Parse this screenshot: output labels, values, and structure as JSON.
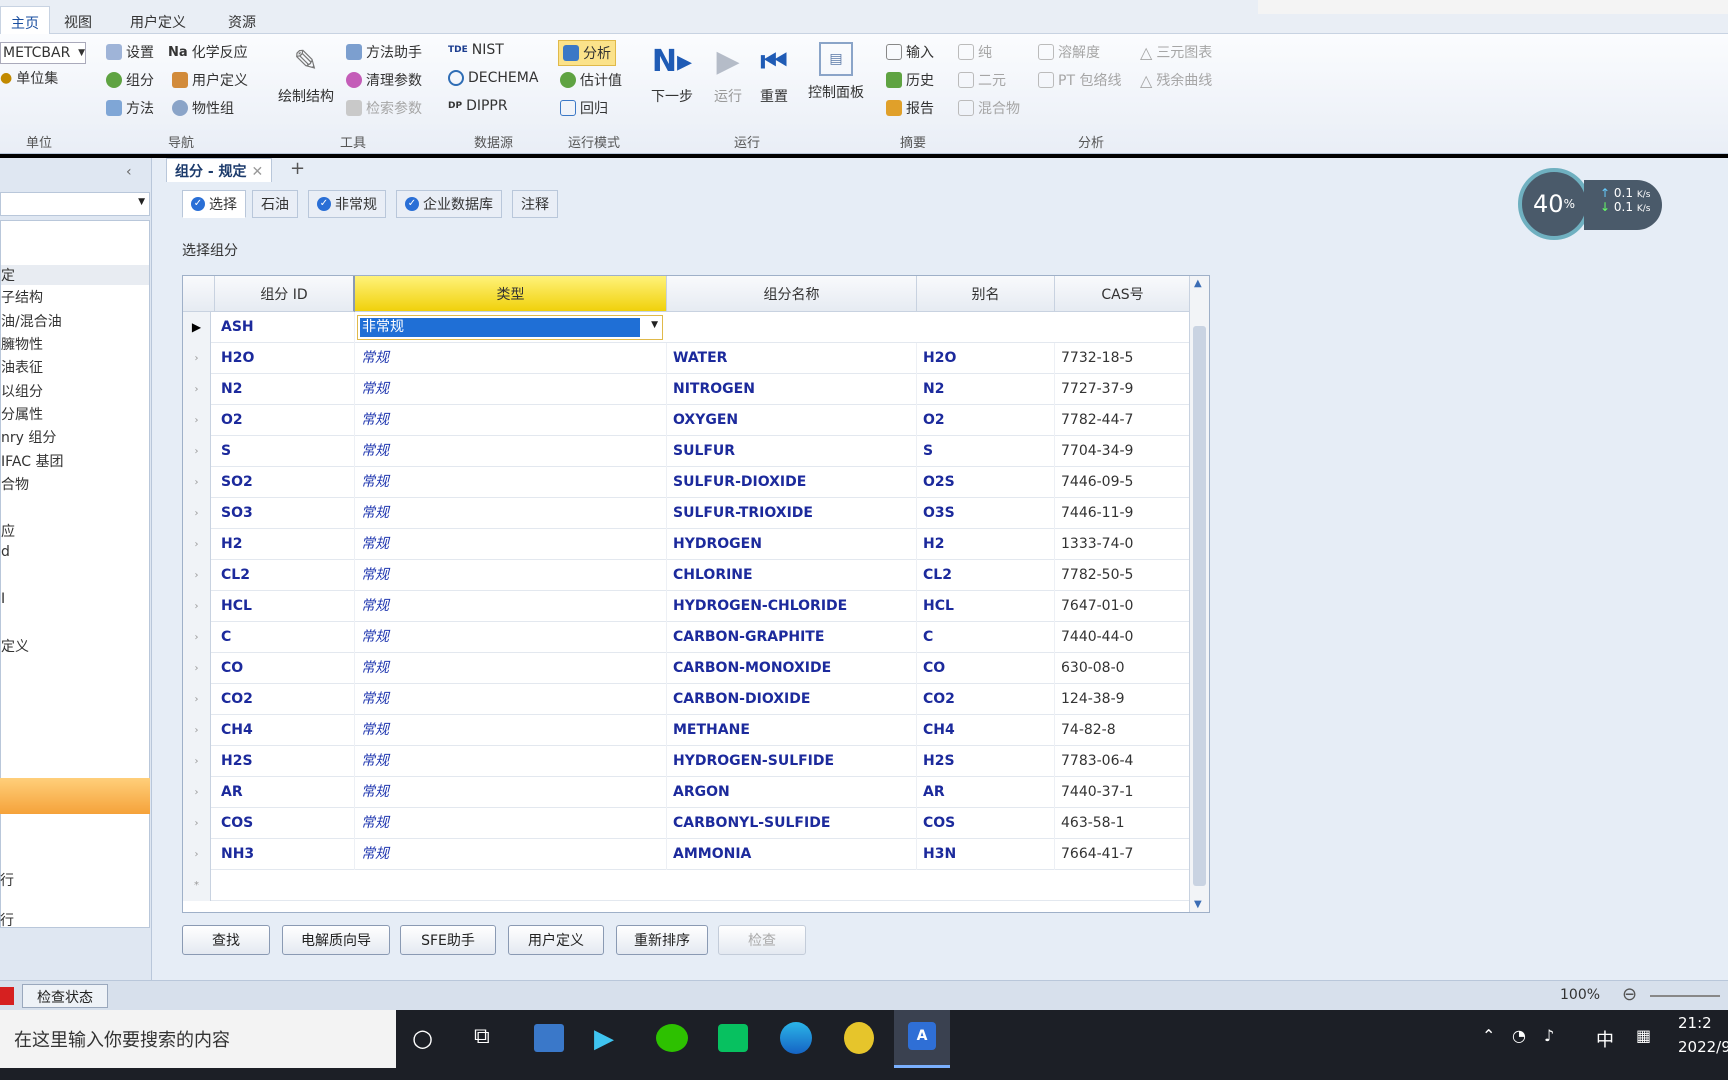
{
  "ribbon_tabs": [
    "主页",
    "视图",
    "用户定义",
    "资源"
  ],
  "units_select": "METCBAR",
  "ribbon": {
    "unit_set": "单位集",
    "nav": [
      "设置",
      "组分",
      "方法",
      "化学反应",
      "用户定义",
      "物性组"
    ],
    "draw_structure": "绘制结构",
    "tools": [
      "方法助手",
      "清理参数",
      "检索参数"
    ],
    "datasource": [
      "NIST",
      "DECHEMA",
      "DIPPR"
    ],
    "run_mode": [
      "分析",
      "估计值",
      "回归"
    ],
    "run": [
      "下一步",
      "运行",
      "重置",
      "控制面板"
    ],
    "summary": [
      "输入",
      "历史",
      "报告"
    ],
    "analysis": [
      "纯",
      "二元",
      "混合物",
      "溶解度",
      "PT 包络线",
      "三元图表",
      "残余曲线"
    ],
    "groups": [
      "单位",
      "导航",
      "工具",
      "数据源",
      "运行模式",
      "运行",
      "摘要",
      "分析"
    ]
  },
  "speed_widget": {
    "percent": "40",
    "unit": "%",
    "up": "0.1",
    "down": "0.1",
    "rate_unit": "K/s"
  },
  "leftnav": {
    "items": [
      "定",
      "子结构",
      "油/混合油",
      "臃物性",
      "油表征",
      "以组分",
      "分属性",
      "nry 组分",
      "IFAC 基团",
      "合物",
      "",
      "应",
      "d",
      "",
      "I",
      "",
      "定义"
    ],
    "bottom_items": [
      "行",
      "行"
    ]
  },
  "doc_tab": "组分 - 规定",
  "sub_tabs": [
    "选择",
    "石油",
    "非常规",
    "企业数据库",
    "注释"
  ],
  "section_title": "选择组分",
  "table": {
    "headers": [
      "组分 ID",
      "类型",
      "组分名称",
      "别名",
      "CAS号"
    ],
    "first_row": {
      "id": "ASH",
      "type": "非常规"
    },
    "rows": [
      [
        "H2O",
        "常规",
        "WATER",
        "H2O",
        "7732-18-5"
      ],
      [
        "N2",
        "常规",
        "NITROGEN",
        "N2",
        "7727-37-9"
      ],
      [
        "O2",
        "常规",
        "OXYGEN",
        "O2",
        "7782-44-7"
      ],
      [
        "S",
        "常规",
        "SULFUR",
        "S",
        "7704-34-9"
      ],
      [
        "SO2",
        "常规",
        "SULFUR-DIOXIDE",
        "O2S",
        "7446-09-5"
      ],
      [
        "SO3",
        "常规",
        "SULFUR-TRIOXIDE",
        "O3S",
        "7446-11-9"
      ],
      [
        "H2",
        "常规",
        "HYDROGEN",
        "H2",
        "1333-74-0"
      ],
      [
        "CL2",
        "常规",
        "CHLORINE",
        "CL2",
        "7782-50-5"
      ],
      [
        "HCL",
        "常规",
        "HYDROGEN-CHLORIDE",
        "HCL",
        "7647-01-0"
      ],
      [
        "C",
        "常规",
        "CARBON-GRAPHITE",
        "C",
        "7440-44-0"
      ],
      [
        "CO",
        "常规",
        "CARBON-MONOXIDE",
        "CO",
        "630-08-0"
      ],
      [
        "CO2",
        "常规",
        "CARBON-DIOXIDE",
        "CO2",
        "124-38-9"
      ],
      [
        "CH4",
        "常规",
        "METHANE",
        "CH4",
        "74-82-8"
      ],
      [
        "H2S",
        "常规",
        "HYDROGEN-SULFIDE",
        "H2S",
        "7783-06-4"
      ],
      [
        "AR",
        "常规",
        "ARGON",
        "AR",
        "7440-37-1"
      ],
      [
        "COS",
        "常规",
        "CARBONYL-SULFIDE",
        "COS",
        "463-58-1"
      ],
      [
        "NH3",
        "常规",
        "AMMONIA",
        "H3N",
        "7664-41-7"
      ]
    ]
  },
  "buttons": [
    "查找",
    "电解质向导",
    "SFE助手",
    "用户定义",
    "重新排序",
    "检查"
  ],
  "status": {
    "check": "检查状态",
    "zoom": "100%"
  },
  "taskbar": {
    "search_placeholder": "在这里输入你要搜索的内容",
    "ime": "中",
    "time": "21:2",
    "date": "2022/9"
  }
}
